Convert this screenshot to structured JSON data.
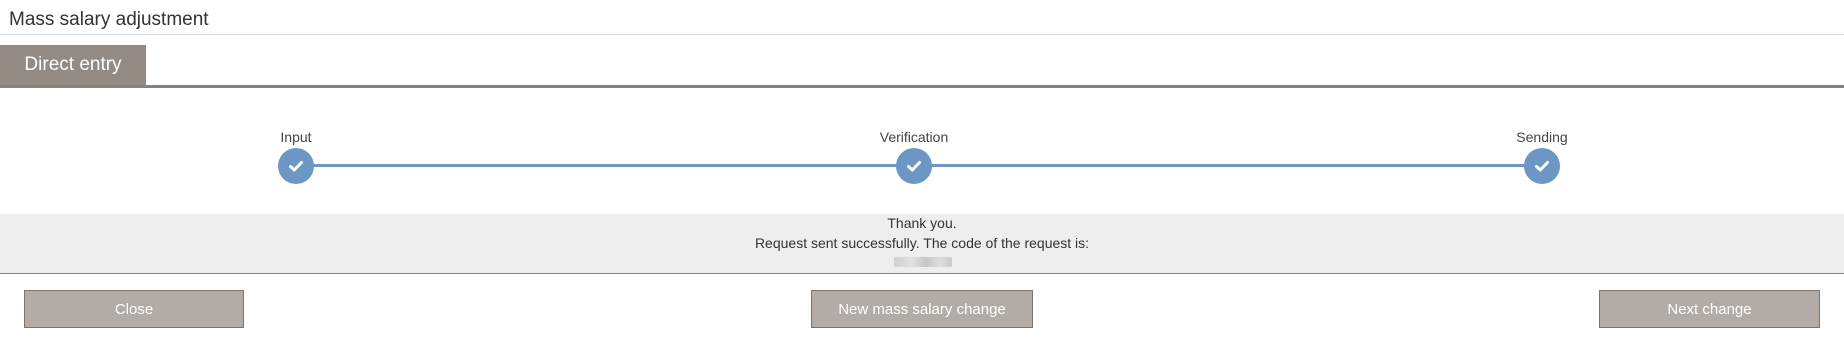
{
  "page": {
    "title": "Mass salary adjustment"
  },
  "tabs": [
    {
      "label": "Direct entry",
      "active": true
    }
  ],
  "steps": [
    {
      "label": "Input",
      "status": "completed",
      "icon": "check-icon"
    },
    {
      "label": "Verification",
      "status": "completed",
      "icon": "check-icon"
    },
    {
      "label": "Sending",
      "status": "completed",
      "icon": "check-icon"
    }
  ],
  "message": {
    "line1": "Thank you.",
    "line2": "Request sent successfully. The code of the request is:"
  },
  "buttons": {
    "close": "Close",
    "new_change": "New mass salary change",
    "next_change": "Next change"
  },
  "colors": {
    "tab_active": "#948a84",
    "step_accent": "#6c97c5",
    "button_bg": "#b3aba6",
    "message_panel_bg": "#eeeeee"
  }
}
